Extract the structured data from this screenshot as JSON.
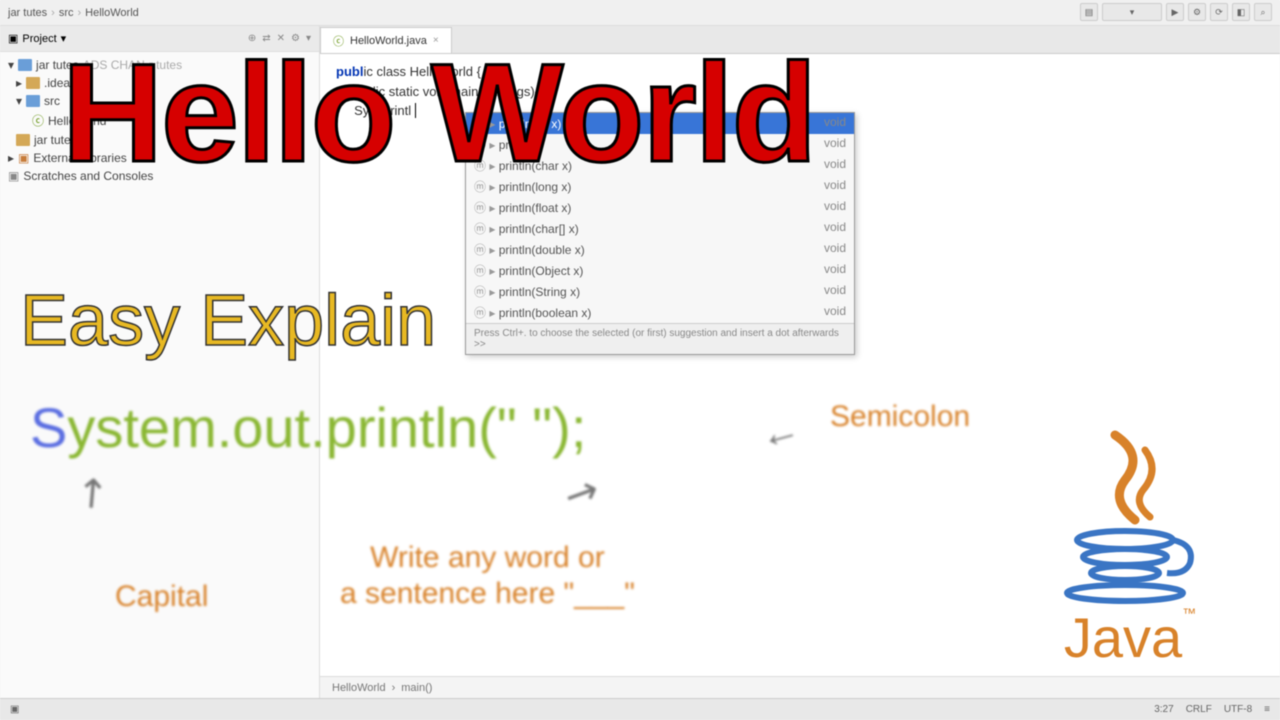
{
  "breadcrumb": {
    "a": "jar tutes",
    "b": "src",
    "c": "HelloWorld"
  },
  "toolbar_icons": [
    "▤",
    "▾",
    "▶",
    "⚙",
    "⟳",
    "◧",
    "⌕"
  ],
  "project_panel": {
    "title": "Project",
    "actions": [
      "⊕",
      "⇄",
      "✕",
      "⚙",
      "▾"
    ],
    "tree": [
      {
        "t": "jar tutes",
        "l": 0,
        "suffix": "ADS CHAN",
        "suffix2": "r tutes"
      },
      {
        "t": ".idea",
        "l": 1
      },
      {
        "t": "src",
        "l": 1
      },
      {
        "t": "HelloWorld",
        "l": 2
      },
      {
        "t": "jar tutes",
        "l": 1
      },
      {
        "t": "External Libraries",
        "l": 0
      },
      {
        "t": "Scratches and Consoles",
        "l": 0
      }
    ]
  },
  "editor": {
    "tab": "HelloWorld.java",
    "code_line1": "ic class HelloWorld {",
    "code_line2": "ublic static void main(Stri",
    "code_line3": "    Syst      printl",
    "status_left": "HelloWorld",
    "status_right": "main()"
  },
  "autocomplete": {
    "items": [
      {
        "sig": "println(int x)",
        "ret": "void",
        "sel": true
      },
      {
        "sig": "println()",
        "ret": "void"
      },
      {
        "sig": "println(char x)",
        "ret": "void"
      },
      {
        "sig": "println(long x)",
        "ret": "void"
      },
      {
        "sig": "println(float x)",
        "ret": "void"
      },
      {
        "sig": "println(char[] x)",
        "ret": "void"
      },
      {
        "sig": "println(double x)",
        "ret": "void"
      },
      {
        "sig": "println(Object x)",
        "ret": "void"
      },
      {
        "sig": "println(String x)",
        "ret": "void"
      },
      {
        "sig": "println(boolean x)",
        "ret": "void"
      }
    ],
    "hint": "Press Ctrl+. to choose the selected (or first) suggestion and insert a dot afterwards  >>"
  },
  "statusbar": {
    "pos": "3:27",
    "crlf": "CRLF",
    "enc": "UTF-8",
    "ins": "≡"
  },
  "overlay": {
    "hello": "Hello World",
    "easy": "Easy Explain",
    "code_cap": "S",
    "code_body": "ystem.out.println(\" \")",
    "code_semi": ";",
    "capital": "Capital",
    "sentence_l1": "Write any word or",
    "sentence_l2": "a sentence here \"___\"",
    "semicolon": "Semicolon",
    "java": "Java",
    "tm": "™"
  }
}
